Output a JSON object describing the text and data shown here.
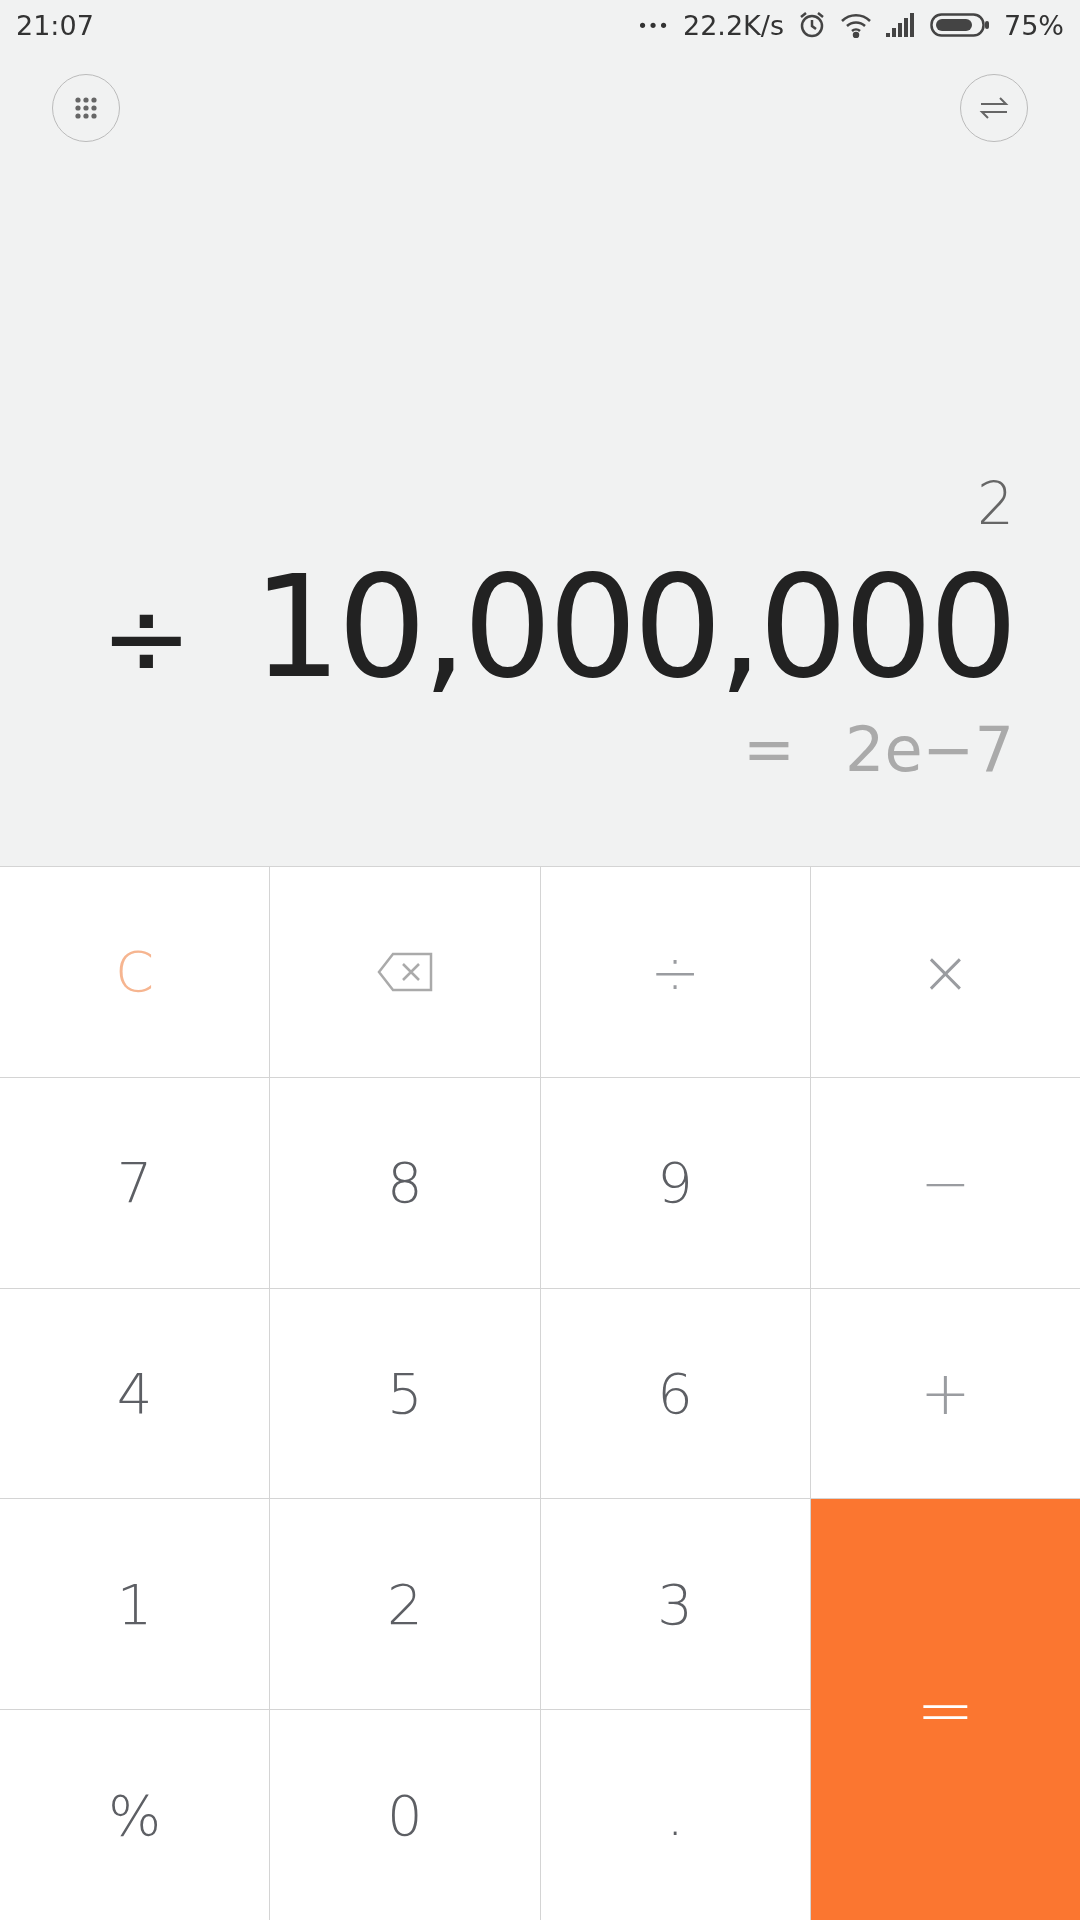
{
  "status_bar": {
    "time": "21:07",
    "dots": "•••",
    "speed": "22.2K/s",
    "battery": "75%"
  },
  "display": {
    "previous": "2",
    "operator": "÷",
    "expression": "10,000,000",
    "result_sign": "=",
    "result": "2e−7"
  },
  "keys": [
    {
      "kind": "clear",
      "label": "C"
    },
    {
      "kind": "backspace"
    },
    {
      "kind": "operator",
      "label": "÷"
    },
    {
      "kind": "operator",
      "label": "×"
    },
    {
      "kind": "digit",
      "label": "7"
    },
    {
      "kind": "digit",
      "label": "8"
    },
    {
      "kind": "digit",
      "label": "9"
    },
    {
      "kind": "operator",
      "label": "−"
    },
    {
      "kind": "digit",
      "label": "4"
    },
    {
      "kind": "digit",
      "label": "5"
    },
    {
      "kind": "digit",
      "label": "6"
    },
    {
      "kind": "operator",
      "label": "+"
    },
    {
      "kind": "digit",
      "label": "1"
    },
    {
      "kind": "digit",
      "label": "2"
    },
    {
      "kind": "digit",
      "label": "3"
    },
    {
      "kind": "equals",
      "label": "="
    },
    {
      "kind": "digit",
      "label": "%"
    },
    {
      "kind": "digit",
      "label": "0"
    },
    {
      "kind": "digit",
      "label": "."
    }
  ]
}
